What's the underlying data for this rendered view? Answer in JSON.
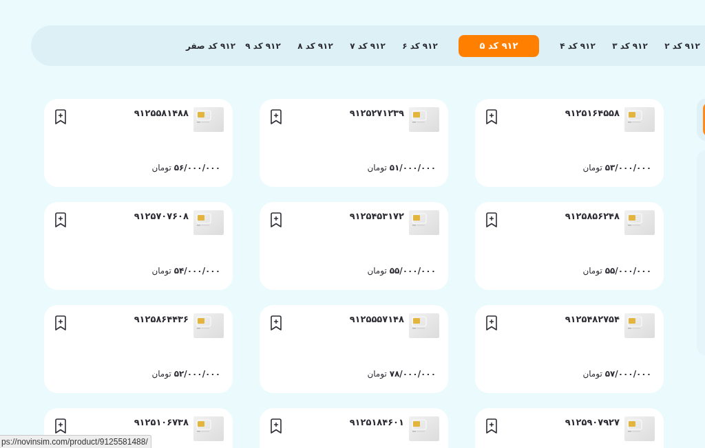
{
  "tabs": [
    {
      "label": "۹۱۲ کد ۲",
      "selected": false
    },
    {
      "label": "۹۱۲ کد ۳",
      "selected": false
    },
    {
      "label": "۹۱۲ کد ۴",
      "selected": false
    },
    {
      "label": "۹۱۲ کد ۵",
      "selected": true
    },
    {
      "label": "۹۱۲ کد ۶",
      "selected": false
    },
    {
      "label": "۹۱۲ کد ۷",
      "selected": false
    },
    {
      "label": "۹۱۲ کد ۸",
      "selected": false
    },
    {
      "label": "۹۱۲ کد ۹",
      "selected": false
    },
    {
      "label": "۹۱۲ کد صفر",
      "selected": false
    }
  ],
  "listings": [
    {
      "number": "۹۱۲۵۱۶۴۵۵۸",
      "price": "**۵۳/۰۰۰/۰۰۰** تومان"
    },
    {
      "number": "۹۱۲۵۲۷۱۲۳۹",
      "price": "**۵۱/۰۰۰/۰۰۰** تومان"
    },
    {
      "number": "۹۱۲۵۵۸۱۴۸۸",
      "price": "**۵۶/۰۰۰/۰۰۰** تومان"
    },
    {
      "number": "۹۱۲۵۸۵۶۲۴۸",
      "price": "**۵۵/۰۰۰/۰۰۰** تومان"
    },
    {
      "number": "۹۱۲۵۴۵۳۱۷۲",
      "price": "**۵۵/۰۰۰/۰۰۰** تومان"
    },
    {
      "number": "۹۱۲۵۷۰۷۶۰۸",
      "price": "**۵۴/۰۰۰/۰۰۰** تومان"
    },
    {
      "number": "۹۱۲۵۴۸۲۷۵۴",
      "price": "**۵۷/۰۰۰/۰۰۰** تومان"
    },
    {
      "number": "۹۱۲۵۵۵۷۱۴۸",
      "price": "**۷۸/۰۰۰/۰۰۰** تومان"
    },
    {
      "number": "۹۱۲۵۸۶۴۴۳۶",
      "price": "**۵۲/۰۰۰/۰۰۰** تومان"
    },
    {
      "number": "۹۱۲۵۹۰۷۹۲۷"
    },
    {
      "number": "۹۱۲۵۱۸۴۶۰۱"
    },
    {
      "number": "۹۱۲۵۱۰۶۷۳۸"
    }
  ],
  "status_bar": {
    "url": "ps://novinsim.com/product/9125581488/"
  }
}
